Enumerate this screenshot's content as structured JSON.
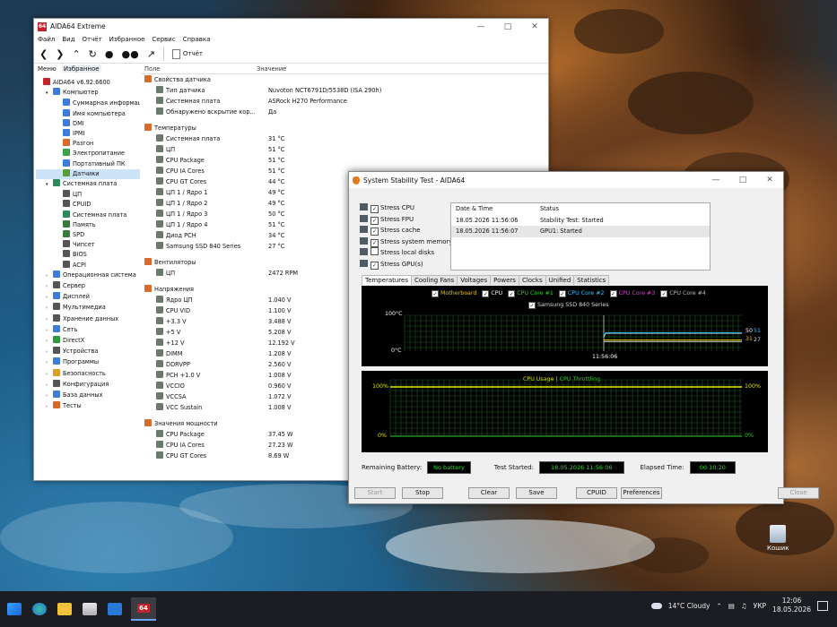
{
  "main": {
    "title": "AIDA64 Extreme",
    "menu": [
      "Файл",
      "Вид",
      "Отчёт",
      "Избранное",
      "Сервис",
      "Справка"
    ],
    "report_label": "Отчёт",
    "panel_tabs": [
      "Меню",
      "Избранное"
    ],
    "tree": [
      {
        "label": "AIDA64 v6.92.6600",
        "color": "#c4232b",
        "indent": 0
      },
      {
        "label": "Компьютер",
        "color": "#3b7dd8",
        "indent": 1
      },
      {
        "label": "Суммарная информация",
        "color": "#3b7dd8",
        "indent": 2
      },
      {
        "label": "Имя компьютера",
        "color": "#3b7dd8",
        "indent": 2
      },
      {
        "label": "DMI",
        "color": "#3b7dd8",
        "indent": 2
      },
      {
        "label": "IPMI",
        "color": "#3b7dd8",
        "indent": 2
      },
      {
        "label": "Разгон",
        "color": "#d86a2a",
        "indent": 2
      },
      {
        "label": "Электропитание",
        "color": "#3aa04a",
        "indent": 2
      },
      {
        "label": "Портативный ПК",
        "color": "#3b7dd8",
        "indent": 2
      },
      {
        "label": "Датчики",
        "color": "#5a9b3a",
        "indent": 2,
        "selected": true
      },
      {
        "label": "Системная плата",
        "color": "#2d8a5a",
        "indent": 1
      },
      {
        "label": "ЦП",
        "color": "#555",
        "indent": 2
      },
      {
        "label": "CPUID",
        "color": "#555",
        "indent": 2
      },
      {
        "label": "Системная плата",
        "color": "#2d8a5a",
        "indent": 2
      },
      {
        "label": "Память",
        "color": "#3a7a3a",
        "indent": 2
      },
      {
        "label": "SPD",
        "color": "#3a7a3a",
        "indent": 2
      },
      {
        "label": "Чипсет",
        "color": "#555",
        "indent": 2
      },
      {
        "label": "BIOS",
        "color": "#555",
        "indent": 2
      },
      {
        "label": "ACPI",
        "color": "#555",
        "indent": 2
      },
      {
        "label": "Операционная система",
        "color": "#3b7dd8",
        "indent": 1
      },
      {
        "label": "Сервер",
        "color": "#555",
        "indent": 1
      },
      {
        "label": "Дисплей",
        "color": "#3b7dd8",
        "indent": 1
      },
      {
        "label": "Мультимедиа",
        "color": "#555",
        "indent": 1
      },
      {
        "label": "Хранение данных",
        "color": "#555",
        "indent": 1
      },
      {
        "label": "Сеть",
        "color": "#3b7dd8",
        "indent": 1
      },
      {
        "label": "DirectX",
        "color": "#2a9a3a",
        "indent": 1
      },
      {
        "label": "Устройства",
        "color": "#555",
        "indent": 1
      },
      {
        "label": "Программы",
        "color": "#3b7dd8",
        "indent": 1
      },
      {
        "label": "Безопасность",
        "color": "#d8a02a",
        "indent": 1
      },
      {
        "label": "Конфигурация",
        "color": "#555",
        "indent": 1
      },
      {
        "label": "База данных",
        "color": "#3b7dd8",
        "indent": 1
      },
      {
        "label": "Тесты",
        "color": "#d86a2a",
        "indent": 1
      }
    ],
    "list_headers": {
      "field": "Поле",
      "value": "Значение"
    },
    "list": [
      {
        "field": "Свойства датчика",
        "value": "",
        "group": true
      },
      {
        "field": "Тип датчика",
        "value": "Nuvoton NCT6791D/5538D  (ISA 290h)"
      },
      {
        "field": "Системная плата",
        "value": "ASRock H270 Performance"
      },
      {
        "field": "Обнаружено вскрытие кор...",
        "value": "Да"
      },
      {
        "gap": true
      },
      {
        "field": "Температуры",
        "value": "",
        "group": true
      },
      {
        "field": "Системная плата",
        "value": "31 °C"
      },
      {
        "field": "ЦП",
        "value": "51 °C"
      },
      {
        "field": "CPU Package",
        "value": "51 °C"
      },
      {
        "field": "CPU IA Cores",
        "value": "51 °C"
      },
      {
        "field": "CPU GT Cores",
        "value": "44 °C"
      },
      {
        "field": "ЦП 1 / Ядро 1",
        "value": "49 °C"
      },
      {
        "field": "ЦП 1 / Ядро 2",
        "value": "49 °C"
      },
      {
        "field": "ЦП 1 / Ядро 3",
        "value": "50 °C"
      },
      {
        "field": "ЦП 1 / Ядро 4",
        "value": "51 °C"
      },
      {
        "field": "Диод PCH",
        "value": "34 °C"
      },
      {
        "field": "Samsung SSD 840 Series",
        "value": "27 °C"
      },
      {
        "gap": true
      },
      {
        "field": "Вентиляторы",
        "value": "",
        "group": true
      },
      {
        "field": "ЦП",
        "value": "2472 RPM"
      },
      {
        "gap": true
      },
      {
        "field": "Напряжения",
        "value": "",
        "group": true
      },
      {
        "field": "Ядро ЦП",
        "value": "1.040 V"
      },
      {
        "field": "CPU VID",
        "value": "1.100 V"
      },
      {
        "field": "+3.3 V",
        "value": "3.488 V"
      },
      {
        "field": "+5 V",
        "value": "5.208 V"
      },
      {
        "field": "+12 V",
        "value": "12.192 V"
      },
      {
        "field": "DIMM",
        "value": "1.208 V"
      },
      {
        "field": "DDRVPP",
        "value": "2.560 V"
      },
      {
        "field": "PCH +1.0 V",
        "value": "1.008 V"
      },
      {
        "field": "VCCIO",
        "value": "0.960 V"
      },
      {
        "field": "VCCSA",
        "value": "1.072 V"
      },
      {
        "field": "VCC Sustain",
        "value": "1.008 V"
      },
      {
        "gap": true
      },
      {
        "field": "Значения мощности",
        "value": "",
        "group": true
      },
      {
        "field": "CPU Package",
        "value": "37.45 W"
      },
      {
        "field": "CPU IA Cores",
        "value": "27.23 W"
      },
      {
        "field": "CPU GT Cores",
        "value": "8.69 W"
      }
    ]
  },
  "stability": {
    "title": "System Stability Test - AIDA64",
    "checks": [
      {
        "label": "Stress CPU",
        "checked": true
      },
      {
        "label": "Stress FPU",
        "checked": true
      },
      {
        "label": "Stress cache",
        "checked": true
      },
      {
        "label": "Stress system memory",
        "checked": true
      },
      {
        "label": "Stress local disks",
        "checked": false
      },
      {
        "label": "Stress GPU(s)",
        "checked": true
      }
    ],
    "log_headers": {
      "date": "Date & Time",
      "status": "Status"
    },
    "log": [
      {
        "date": "18.05.2026 11:56:06",
        "status": "Stability Test: Started"
      },
      {
        "date": "18.05.2026 11:56:07",
        "status": "GPU1: Started"
      }
    ],
    "tabs": [
      "Temperatures",
      "Cooling Fans",
      "Voltages",
      "Powers",
      "Clocks",
      "Unified",
      "Statistics"
    ],
    "temp_legend": [
      {
        "label": "Motherboard",
        "color": "#e8c400"
      },
      {
        "label": "CPU",
        "color": "#ffffff"
      },
      {
        "label": "CPU Core #1",
        "color": "#2fd22f"
      },
      {
        "label": "CPU Core #2",
        "color": "#36c6ff"
      },
      {
        "label": "CPU Core #3",
        "color": "#e040e0"
      },
      {
        "label": "CPU Core #4",
        "color": "#b8b8b8"
      },
      {
        "label": "Samsung SSD 840 Series",
        "color": "#d8d8d8"
      }
    ],
    "temp_y_top": "100°C",
    "temp_y_bottom": "0°C",
    "temp_time": "11:56:06",
    "temp_right_values": [
      "50",
      "51",
      "31",
      "27"
    ],
    "usage_legend": [
      {
        "label": "CPU Usage",
        "color": "#e8e800"
      },
      {
        "label": "CPU Throttling",
        "color": "#2fd22f"
      }
    ],
    "usage_left_top": "100%",
    "usage_left_bottom": "0%",
    "usage_right_top": "100%",
    "usage_right_bottom": "0%",
    "remaining_battery_label": "Remaining Battery:",
    "remaining_battery_value": "No battery",
    "test_started_label": "Test Started:",
    "test_started_value": "18.05.2026 11:56:06",
    "elapsed_label": "Elapsed Time:",
    "elapsed_value": "00:10:20",
    "buttons": [
      "Start",
      "Stop",
      "Clear",
      "Save",
      "CPUID",
      "Preferences",
      "Close"
    ]
  },
  "desktop": {
    "recycle_bin_label": "Кошик"
  },
  "taskbar": {
    "weather": "14°C  Cloudy",
    "language": "УКР",
    "time": "12:06",
    "date": "18.05.2026",
    "app_badge": "64"
  }
}
